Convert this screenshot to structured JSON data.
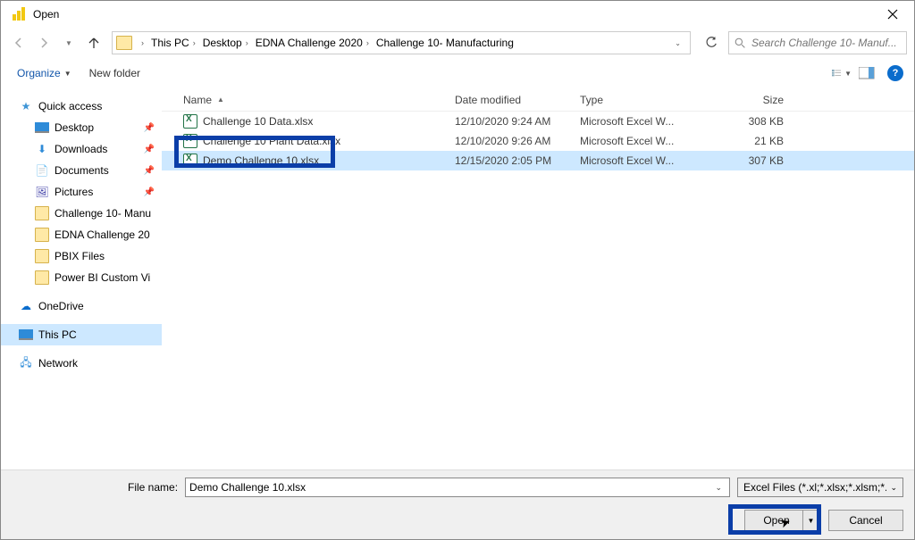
{
  "window": {
    "title": "Open"
  },
  "breadcrumbs": [
    "This PC",
    "Desktop",
    "EDNA Challenge 2020",
    "Challenge 10- Manufacturing"
  ],
  "search": {
    "placeholder": "Search Challenge 10- Manuf..."
  },
  "toolbar": {
    "organize": "Organize",
    "newfolder": "New folder"
  },
  "sidebar": {
    "quick": "Quick access",
    "desktop": "Desktop",
    "downloads": "Downloads",
    "documents": "Documents",
    "pictures": "Pictures",
    "c10": "Challenge 10- Manu",
    "edna": "EDNA Challenge 20",
    "pbix": "PBIX Files",
    "pbicustom": "Power BI Custom Vi",
    "onedrive": "OneDrive",
    "thispc": "This PC",
    "network": "Network"
  },
  "columns": {
    "name": "Name",
    "date": "Date modified",
    "type": "Type",
    "size": "Size"
  },
  "files": [
    {
      "name": "Challenge 10 Data.xlsx",
      "date": "12/10/2020 9:24 AM",
      "type": "Microsoft Excel W...",
      "size": "308 KB"
    },
    {
      "name": "Challenge 10 Plant Data.xlsx",
      "date": "12/10/2020 9:26 AM",
      "type": "Microsoft Excel W...",
      "size": "21 KB"
    },
    {
      "name": "Demo Challenge 10.xlsx",
      "date": "12/15/2020 2:05 PM",
      "type": "Microsoft Excel W...",
      "size": "307 KB"
    }
  ],
  "footer": {
    "filenamelabel": "File name:",
    "filename": "Demo Challenge 10.xlsx",
    "filter": "Excel Files (*.xl;*.xlsx;*.xlsm;*.xl",
    "open": "Open",
    "cancel": "Cancel"
  }
}
